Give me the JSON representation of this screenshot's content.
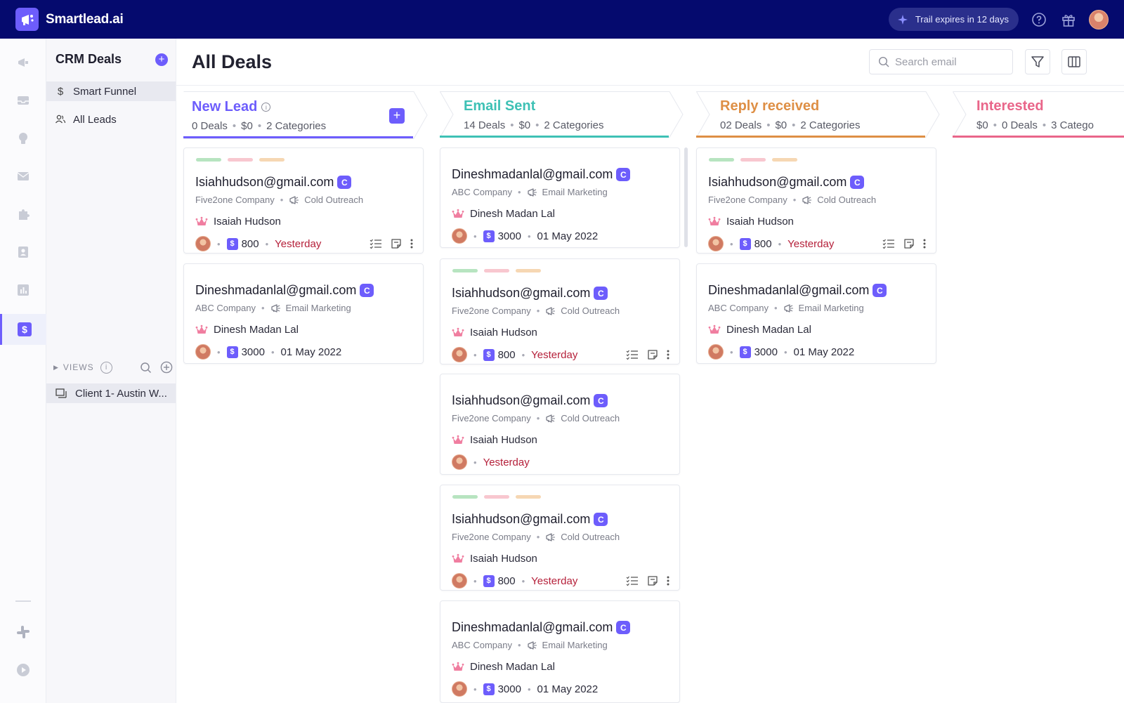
{
  "app": {
    "brand": "Smartlead.ai",
    "trial_text": "Trail expires in 12 days",
    "accent": "#6d5dfc",
    "topbar_color": "#050a6e"
  },
  "rail": {
    "icons": [
      "megaphone-icon",
      "inbox-icon",
      "lightbulb-icon",
      "mail-icon",
      "puzzle-icon",
      "contact-icon",
      "bar-chart-icon",
      "dollar-icon",
      "slack-icon",
      "play-icon"
    ],
    "active": "dollar-icon"
  },
  "sidebar": {
    "title": "CRM Deals",
    "items": [
      {
        "label": "Smart Funnel",
        "icon": "dollar-icon"
      },
      {
        "label": "All Leads",
        "icon": "users-icon"
      }
    ],
    "views_label": "VIEWS",
    "views": [
      {
        "label": "Client 1- Austin W..."
      }
    ]
  },
  "main": {
    "title": "All Deals",
    "search_placeholder": "Search email"
  },
  "columns": [
    {
      "title": "New Lead",
      "color": "#6d5dfc",
      "meta": [
        "0 Deals",
        "$0",
        "2 Categories"
      ]
    },
    {
      "title": "Email Sent",
      "color": "#3ec1b5",
      "meta": [
        "14 Deals",
        "$0",
        "2 Categories"
      ]
    },
    {
      "title": "Reply received",
      "color": "#de8f45",
      "meta": [
        "02 Deals",
        "$0",
        "2 Categories"
      ]
    },
    {
      "title": "Interested",
      "color": "#e9668a",
      "meta": [
        "$0",
        "0 Deals",
        "3 Catego"
      ]
    }
  ],
  "cards": {
    "c0_0": {
      "email": "Isiahhudson@gmail.com",
      "badge": "C",
      "company": "Five2one Company",
      "campaign": "Cold Outreach",
      "person": "Isaiah Hudson",
      "amount": "800",
      "when": "Yesterday"
    },
    "c0_1": {
      "email": "Dineshmadanlal@gmail.com",
      "badge": "C",
      "company": "ABC Company",
      "campaign": "Email Marketing",
      "person": "Dinesh Madan Lal",
      "amount": "3000",
      "when": "01 May 2022"
    },
    "c1_0": {
      "email": "Dineshmadanlal@gmail.com",
      "badge": "C",
      "company": "ABC Company",
      "campaign": "Email Marketing",
      "person": "Dinesh Madan Lal",
      "amount": "3000",
      "when": "01 May 2022"
    },
    "c1_1": {
      "email": "Isiahhudson@gmail.com",
      "badge": "C",
      "company": "Five2one Company",
      "campaign": "Cold Outreach",
      "person": "Isaiah Hudson",
      "amount": "800",
      "when": "Yesterday"
    },
    "c1_2": {
      "email": "Isiahhudson@gmail.com",
      "badge": "C",
      "company": "Five2one Company",
      "campaign": "Cold Outreach",
      "person": "Isaiah Hudson",
      "when": "Yesterday"
    },
    "c1_3": {
      "email": "Isiahhudson@gmail.com",
      "badge": "C",
      "company": "Five2one Company",
      "campaign": "Cold Outreach",
      "person": "Isaiah Hudson",
      "amount": "800",
      "when": "Yesterday"
    },
    "c1_4": {
      "email": "Dineshmadanlal@gmail.com",
      "badge": "C",
      "company": "ABC Company",
      "campaign": "Email Marketing",
      "person": "Dinesh Madan Lal",
      "amount": "3000",
      "when": "01 May 2022"
    },
    "c2_0": {
      "email": "Isiahhudson@gmail.com",
      "badge": "C",
      "company": "Five2one Company",
      "campaign": "Cold Outreach",
      "person": "Isaiah Hudson",
      "amount": "800",
      "when": "Yesterday"
    },
    "c2_1": {
      "email": "Dineshmadanlal@gmail.com",
      "badge": "C",
      "company": "ABC Company",
      "campaign": "Email Marketing",
      "person": "Dinesh Madan Lal",
      "amount": "3000",
      "when": "01 May 2022"
    }
  },
  "tag_colors": [
    "#b7e4c0",
    "#f8c7cf",
    "#f6d7b3"
  ]
}
